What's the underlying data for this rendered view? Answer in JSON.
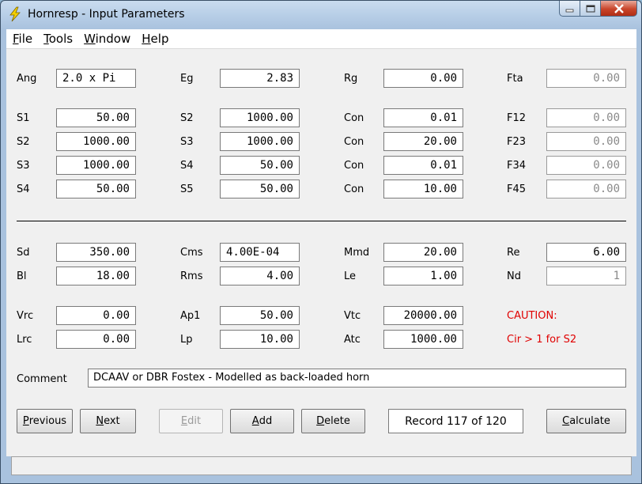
{
  "window": {
    "title": "Hornresp - Input Parameters"
  },
  "menu": [
    {
      "first": "F",
      "rest": "ile"
    },
    {
      "first": "T",
      "rest": "ools"
    },
    {
      "first": "W",
      "rest": "indow"
    },
    {
      "first": "H",
      "rest": "elp"
    }
  ],
  "row_ang": {
    "l1": "Ang",
    "v1": "2.0 x Pi",
    "l2": "Eg",
    "v2": "2.83",
    "l3": "Rg",
    "v3": "0.00",
    "l4": "Fta",
    "v4": "0.00"
  },
  "rows_segments": [
    {
      "l1": "S1",
      "v1": "50.00",
      "l2": "S2",
      "v2": "1000.00",
      "l3": "Con",
      "v3": "0.01",
      "l4": "F12",
      "v4": "0.00"
    },
    {
      "l1": "S2",
      "v1": "1000.00",
      "l2": "S3",
      "v2": "1000.00",
      "l3": "Con",
      "v3": "20.00",
      "l4": "F23",
      "v4": "0.00"
    },
    {
      "l1": "S3",
      "v1": "1000.00",
      "l2": "S4",
      "v2": "50.00",
      "l3": "Con",
      "v3": "0.01",
      "l4": "F34",
      "v4": "0.00"
    },
    {
      "l1": "S4",
      "v1": "50.00",
      "l2": "S5",
      "v2": "50.00",
      "l3": "Con",
      "v3": "10.00",
      "l4": "F45",
      "v4": "0.00"
    }
  ],
  "rows_driver": [
    {
      "l1": "Sd",
      "v1": "350.00",
      "l2": "Cms",
      "v2": "4.00E-04",
      "l3": "Mmd",
      "v3": "20.00",
      "l4": "Re",
      "v4": "6.00"
    },
    {
      "l1": "Bl",
      "v1": "18.00",
      "l2": "Rms",
      "v2": "4.00",
      "l3": "Le",
      "v3": "1.00",
      "l4": "Nd",
      "v4": "1"
    }
  ],
  "rows_chamber": [
    {
      "l1": "Vrc",
      "v1": "0.00",
      "l2": "Ap1",
      "v2": "50.00",
      "l3": "Vtc",
      "v3": "20000.00"
    },
    {
      "l1": "Lrc",
      "v1": "0.00",
      "l2": "Lp",
      "v2": "10.00",
      "l3": "Atc",
      "v3": "1000.00"
    }
  ],
  "caution": {
    "title": "CAUTION:",
    "message": "Cir > 1 for S2"
  },
  "comment": {
    "label": "Comment",
    "value": "DCAAV or DBR Fostex - Modelled as back-loaded horn"
  },
  "buttons": {
    "previous": {
      "first": "P",
      "rest": "revious"
    },
    "next": {
      "first": "N",
      "rest": "ext"
    },
    "edit": {
      "first": "E",
      "rest": "dit"
    },
    "add": {
      "first": "A",
      "rest": "dd"
    },
    "delete": {
      "first": "D",
      "rest": "elete"
    },
    "calculate": {
      "first": "C",
      "rest": "alculate"
    }
  },
  "record": "Record 117 of 120",
  "colors": {
    "caution": "#e00000",
    "title_gradient_top": "#c9dcef",
    "close_button": "#c9452b"
  }
}
